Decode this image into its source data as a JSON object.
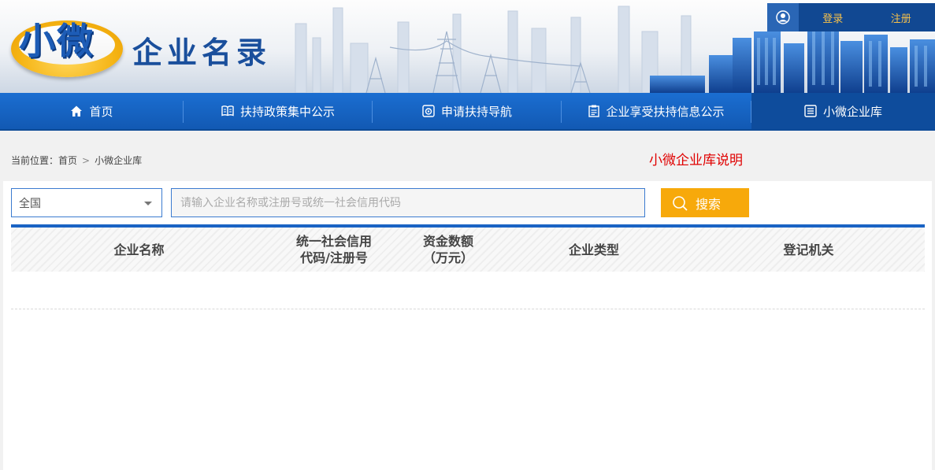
{
  "header": {
    "logo_main": "小微",
    "logo_sub": "企业名录",
    "auth": {
      "login": "登录",
      "register": "注册"
    }
  },
  "nav": {
    "items": [
      {
        "label": "首页",
        "icon": "home-icon"
      },
      {
        "label": "扶持政策集中公示",
        "icon": "book-icon"
      },
      {
        "label": "申请扶持导航",
        "icon": "camera-icon"
      },
      {
        "label": "企业享受扶持信息公示",
        "icon": "clipboard-icon"
      },
      {
        "label": "小微企业库",
        "icon": "list-icon"
      }
    ],
    "active_index": 4
  },
  "breadcrumb": {
    "prefix": "当前位置：",
    "home": "首页",
    "current": "小微企业库"
  },
  "info_link": "小微企业库说明",
  "search": {
    "region": "全国",
    "placeholder": "请输入企业名称或注册号或统一社会信用代码",
    "value": "",
    "button": "搜索"
  },
  "table": {
    "columns": [
      {
        "line1": "企业名称",
        "line2": ""
      },
      {
        "line1": "统一社会信用",
        "line2": "代码/注册号"
      },
      {
        "line1": "资金数额",
        "line2": "（万元）"
      },
      {
        "line1": "企业类型",
        "line2": ""
      },
      {
        "line1": "登记机关",
        "line2": ""
      }
    ],
    "rows": []
  },
  "colors": {
    "nav": "#1b6ed1",
    "accent": "#f7a90b",
    "link_red": "#e00000",
    "auth_text": "#f7c14b"
  }
}
